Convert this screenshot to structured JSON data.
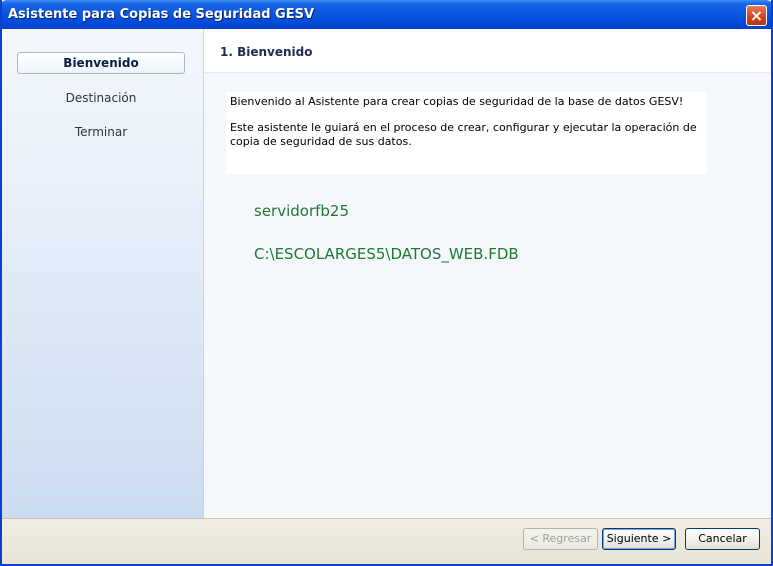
{
  "window": {
    "title": "Asistente para Copias de Seguridad GESV",
    "close_glyph": "×"
  },
  "sidebar": {
    "items": [
      {
        "label": "Bienvenido",
        "active": true
      },
      {
        "label": "Destinación",
        "active": false
      },
      {
        "label": "Terminar",
        "active": false
      }
    ]
  },
  "content": {
    "header": "1. Bienvenido",
    "welcome_line": "Bienvenido al Asistente para crear copias de seguridad de la base de datos GESV!",
    "description": "Este asistente le guiará en el proceso de crear, configurar y ejecutar la operación de copia de seguridad de sus datos.",
    "server": "servidorfb25",
    "database_path": "C:\\ESCOLARGES5\\DATOS_WEB.FDB"
  },
  "buttons": {
    "back": "< Regresar",
    "next": "Siguiente >",
    "cancel": "Cancelar"
  },
  "colors": {
    "title_bar": "#0a55e0",
    "green_text": "#1f7a2f"
  }
}
